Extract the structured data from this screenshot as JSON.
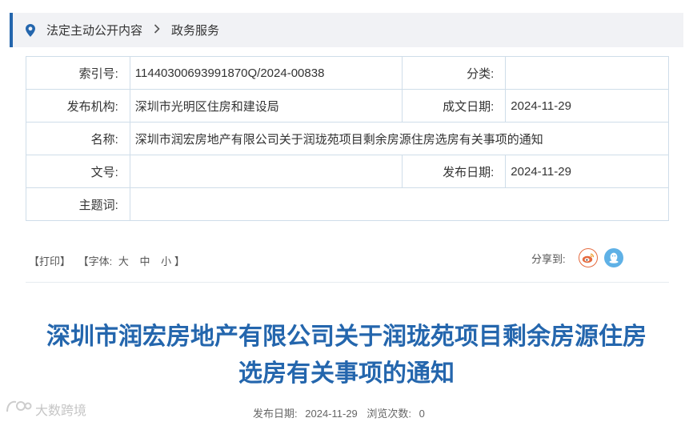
{
  "breadcrumb": {
    "items": [
      "法定主动公开内容",
      "政务服务"
    ]
  },
  "meta": {
    "index_label": "索引号:",
    "index_value": "11440300693991870Q/2024-00838",
    "category_label": "分类:",
    "category_value": "",
    "publisher_label": "发布机构:",
    "publisher_value": "深圳市光明区住房和建设局",
    "created_label": "成文日期:",
    "created_value": "2024-11-29",
    "name_label": "名称:",
    "name_value": "深圳市润宏房地产有限公司关于润珑苑项目剩余房源住房选房有关事项的通知",
    "docno_label": "文号:",
    "docno_value": "",
    "pubdate_label": "发布日期:",
    "pubdate_value": "2024-11-29",
    "subject_label": "主题词:",
    "subject_value": ""
  },
  "tools": {
    "print": "【打印】",
    "font_prefix": "【字体:",
    "font_large": "大",
    "font_medium": "中",
    "font_small": "小",
    "font_suffix": "】",
    "share_label": "分享到:"
  },
  "article": {
    "title_line1": "深圳市润宏房地产有限公司关于润珑苑项目剩余房源住房",
    "title_line2": "选房有关事项的通知",
    "pub_label": "发布日期:",
    "pub_date": "2024-11-29",
    "views_label": "浏览次数:",
    "views_count": "0"
  },
  "watermark": {
    "text": "大数跨境"
  },
  "colors": {
    "accent": "#2466ad",
    "breadcrumb_bg": "#f1f2f5",
    "border": "#cfdde9"
  }
}
